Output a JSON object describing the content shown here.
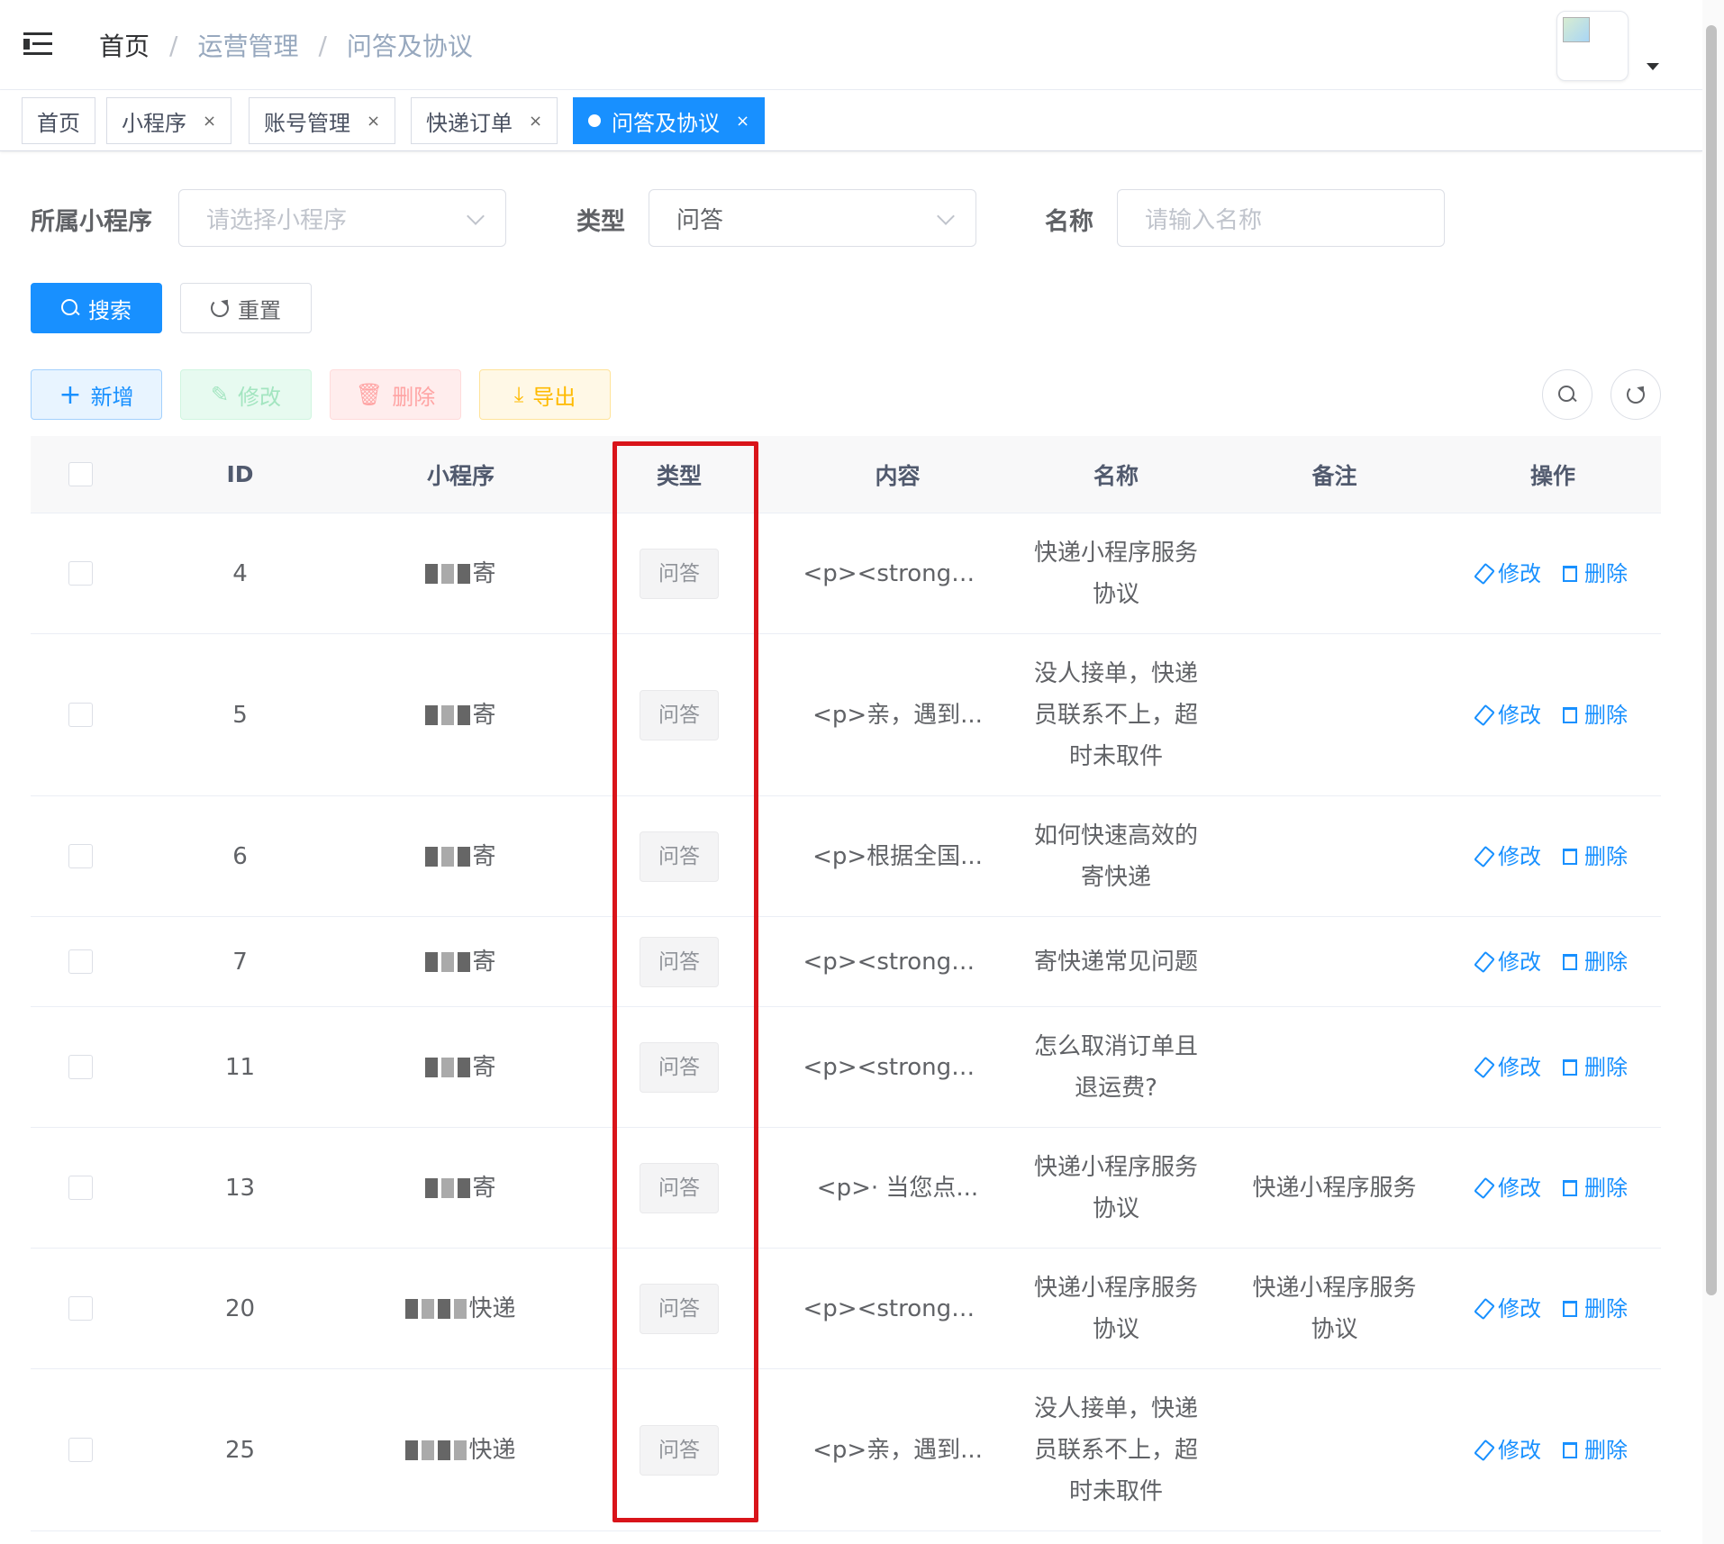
{
  "breadcrumb": {
    "home": "首页",
    "sep1": "/",
    "ops": "运营管理",
    "sep2": "/",
    "current": "问答及协议"
  },
  "tags": [
    {
      "label": "首页",
      "close": ""
    },
    {
      "label": "小程序",
      "close": "×"
    },
    {
      "label": "账号管理",
      "close": "×"
    },
    {
      "label": "快递订单",
      "close": "×"
    },
    {
      "label": "问答及协议",
      "close": "×"
    }
  ],
  "form": {
    "app_label": "所属小程序",
    "app_placeholder": "请选择小程序",
    "type_label": "类型",
    "type_value": "问答",
    "name_label": "名称",
    "name_placeholder": "请输入名称"
  },
  "buttons": {
    "search": "搜索",
    "reset": "重置",
    "add": "新增",
    "edit": "修改",
    "delete": "删除",
    "export": "导出"
  },
  "table": {
    "headers": {
      "id": "ID",
      "app": "小程序",
      "type": "类型",
      "content": "内容",
      "name": "名称",
      "remark": "备注",
      "op": "操作"
    },
    "rows": [
      {
        "id": "4",
        "app": "寄",
        "type": "问答",
        "content": "<p><strong>...",
        "name": "快递小程序服务协议",
        "remark": ""
      },
      {
        "id": "5",
        "app": "寄",
        "type": "问答",
        "content": "<p>亲，遇到...",
        "name": "没人接单，快递员联系不上，超时未取件",
        "remark": ""
      },
      {
        "id": "6",
        "app": "寄",
        "type": "问答",
        "content": "<p>根据全国...",
        "name": "如何快速高效的寄快递",
        "remark": ""
      },
      {
        "id": "7",
        "app": "寄",
        "type": "问答",
        "content": "<p><strong>...",
        "name": "寄快递常见问题",
        "remark": ""
      },
      {
        "id": "11",
        "app": "寄",
        "type": "问答",
        "content": "<p><strong>...",
        "name": "怎么取消订单且退运费?",
        "remark": ""
      },
      {
        "id": "13",
        "app": "寄",
        "type": "问答",
        "content": "<p>· 当您点...",
        "name": "快递小程序服务协议",
        "remark": "快递小程序服务"
      },
      {
        "id": "20",
        "app": "快递",
        "type": "问答",
        "content": "<p><strong>...",
        "name": "快递小程序服务协议",
        "remark": "快递小程序服务协议"
      },
      {
        "id": "25",
        "app": "快递",
        "type": "问答",
        "content": "<p>亲，遇到...",
        "name": "没人接单，快递员联系不上，超时未取件",
        "remark": ""
      }
    ],
    "op_edit": "修改",
    "op_delete": "删除"
  },
  "colors": {
    "primary": "#1890ff",
    "highlight": "#d9141a"
  }
}
